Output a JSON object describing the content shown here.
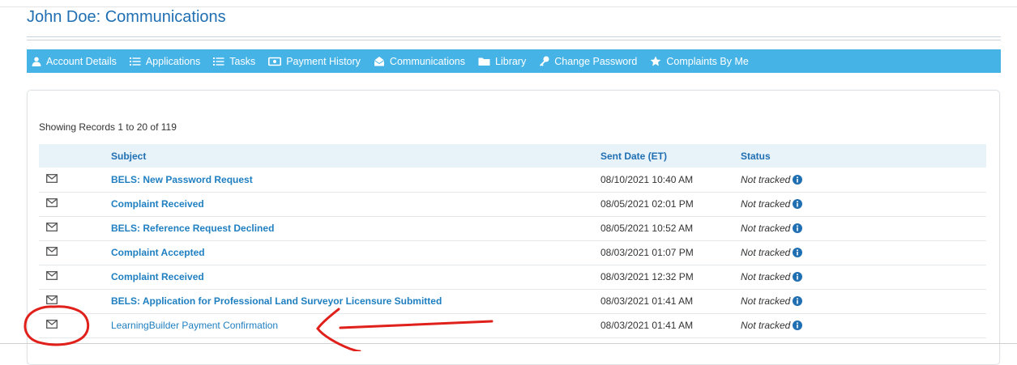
{
  "page": {
    "title": "John Doe: Communications"
  },
  "nav": {
    "items": [
      {
        "label": "Account Details",
        "icon": "user-icon"
      },
      {
        "label": "Applications",
        "icon": "list-icon"
      },
      {
        "label": "Tasks",
        "icon": "list-icon"
      },
      {
        "label": "Payment History",
        "icon": "money-icon"
      },
      {
        "label": "Communications",
        "icon": "envelope-open-icon"
      },
      {
        "label": "Library",
        "icon": "folder-icon"
      },
      {
        "label": "Change Password",
        "icon": "key-icon"
      },
      {
        "label": "Complaints By Me",
        "icon": "star-icon"
      }
    ]
  },
  "records": {
    "showing": "Showing Records 1 to 20 of 119"
  },
  "table": {
    "headers": {
      "subject": "Subject",
      "sent_date": "Sent Date (ET)",
      "status": "Status"
    },
    "rows": [
      {
        "subject": "BELS: New Password Request",
        "sent_date": "08/10/2021 10:40 AM",
        "status": "Not tracked"
      },
      {
        "subject": "Complaint Received",
        "sent_date": "08/05/2021 02:01 PM",
        "status": "Not tracked"
      },
      {
        "subject": "BELS: Reference Request Declined",
        "sent_date": "08/05/2021 10:52 AM",
        "status": "Not tracked"
      },
      {
        "subject": "Complaint Accepted",
        "sent_date": "08/03/2021 01:07 PM",
        "status": "Not tracked"
      },
      {
        "subject": "Complaint Received",
        "sent_date": "08/03/2021 12:32 PM",
        "status": "Not tracked"
      },
      {
        "subject": "BELS: Application for Professional Land Surveyor Licensure Submitted",
        "sent_date": "08/03/2021 01:41 AM",
        "status": "Not tracked"
      },
      {
        "subject": "LearningBuilder Payment Confirmation",
        "sent_date": "08/03/2021 01:41 AM",
        "status": "Not tracked"
      }
    ]
  },
  "colors": {
    "nav_bg": "#45b3e6",
    "link": "#1f7fc0",
    "header_bg": "#e7f2f9",
    "annotation": "#e0201b"
  }
}
